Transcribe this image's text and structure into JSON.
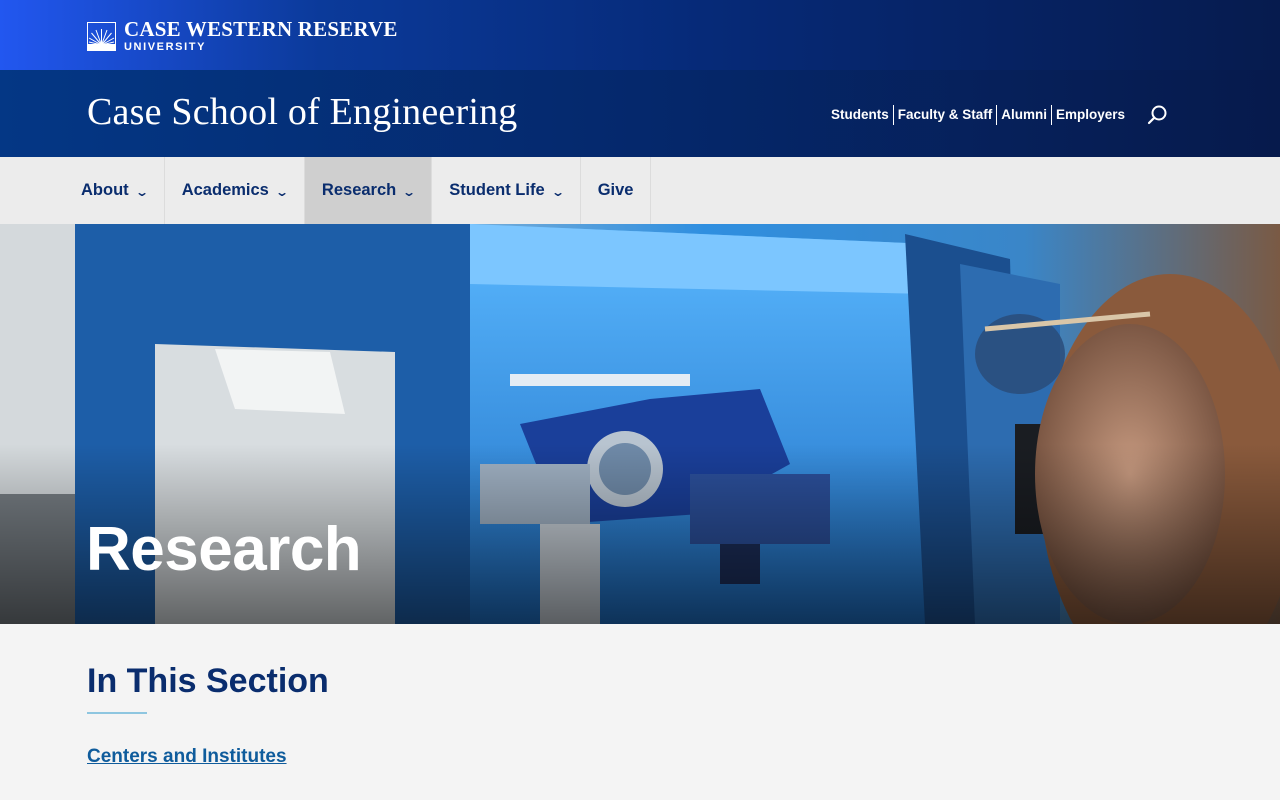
{
  "university": {
    "name_line1": "CASE WESTERN RESERVE",
    "name_line2": "UNIVERSITY",
    "logo_icon": "sunburst-icon"
  },
  "school": {
    "title": "Case School of Engineering"
  },
  "audience_nav": [
    {
      "label": "Students"
    },
    {
      "label": "Faculty & Staff"
    },
    {
      "label": "Alumni"
    },
    {
      "label": "Employers"
    }
  ],
  "search": {
    "icon": "search-icon"
  },
  "main_nav": [
    {
      "label": "About",
      "has_dropdown": true,
      "active": false
    },
    {
      "label": "Academics",
      "has_dropdown": true,
      "active": false
    },
    {
      "label": "Research",
      "has_dropdown": true,
      "active": true
    },
    {
      "label": "Student Life",
      "has_dropdown": true,
      "active": false
    },
    {
      "label": "Give",
      "has_dropdown": false,
      "active": false
    }
  ],
  "hero": {
    "title": "Research"
  },
  "section": {
    "title": "In This Section",
    "links": [
      {
        "label": "Centers and Institutes"
      }
    ]
  },
  "colors": {
    "navy": "#0a2d6e",
    "link": "#0f5c9c",
    "accent_rule": "#8ec6e0",
    "nav_bg": "#ececec",
    "nav_active_bg": "#cfcfcf"
  }
}
